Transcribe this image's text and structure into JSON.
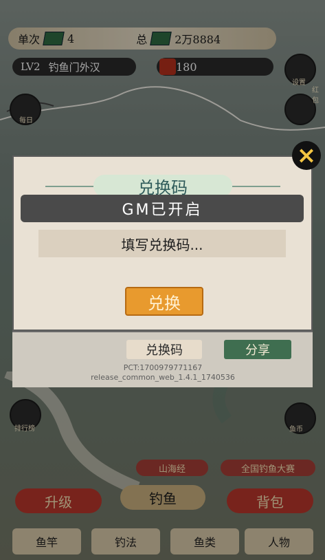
{
  "hud": {
    "single_label": "单次",
    "single_value": "4",
    "total_label": "总",
    "total_value": "2万8884",
    "level": "LV2",
    "title": "钓鱼门外汉",
    "bait_count": "180"
  },
  "left_side": {
    "daily_label": "每日",
    "ranking_label": "排行榜"
  },
  "right_side": {
    "settings_label": "设置",
    "gift_label": "红包",
    "fish_label": "鱼币"
  },
  "bottom_actions": {
    "upgrade": "升级",
    "fish": "钓鱼",
    "bag": "背包",
    "map": "山海经",
    "contest": "全国钓鱼大赛"
  },
  "bottom_nav": {
    "rod": "鱼竿",
    "method": "钓法",
    "fish_type": "鱼类",
    "character": "人物"
  },
  "modal": {
    "title": "兑换码",
    "status": "GM已开启",
    "input_placeholder": "填写兑换码...",
    "confirm": "兑换",
    "close": "×"
  },
  "underlay": {
    "redeem_code": "兑换码",
    "share": "分享",
    "pct": "PCT:1700979771167",
    "release": "release_common_web_1.4.1_1740536"
  }
}
